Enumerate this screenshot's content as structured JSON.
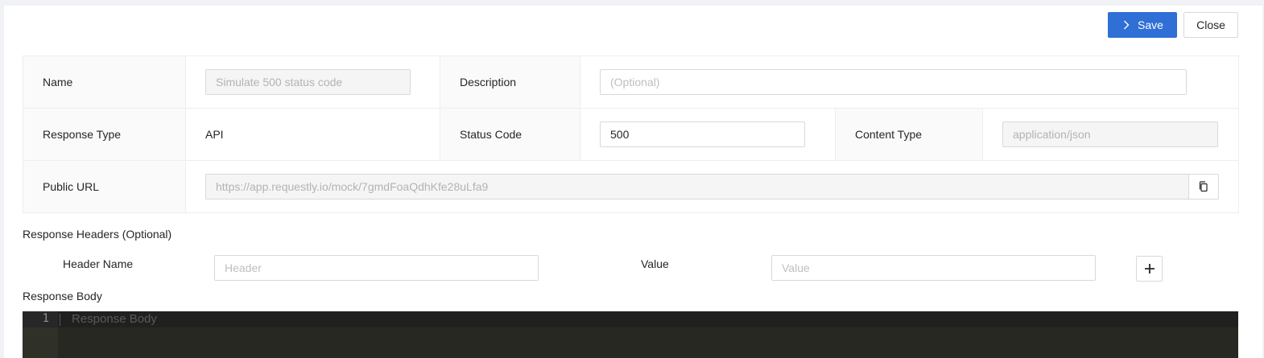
{
  "toolbar": {
    "save_label": "Save",
    "close_label": "Close"
  },
  "details": {
    "name_label": "Name",
    "name_value": "Simulate 500 status code",
    "description_label": "Description",
    "description_placeholder": "(Optional)",
    "response_type_label": "Response Type",
    "response_type_value": "API",
    "status_code_label": "Status Code",
    "status_code_value": "500",
    "content_type_label": "Content Type",
    "content_type_value": "application/json",
    "public_url_label": "Public URL",
    "public_url_value": "https://app.requestly.io/mock/7gmdFoaQdhKfe28uLfa9"
  },
  "headers": {
    "title": "Response Headers (Optional)",
    "name_label": "Header Name",
    "name_placeholder": "Header",
    "value_label": "Value",
    "value_placeholder": "Value"
  },
  "body": {
    "title": "Response Body",
    "line_number": "1",
    "placeholder": "Response Body"
  }
}
